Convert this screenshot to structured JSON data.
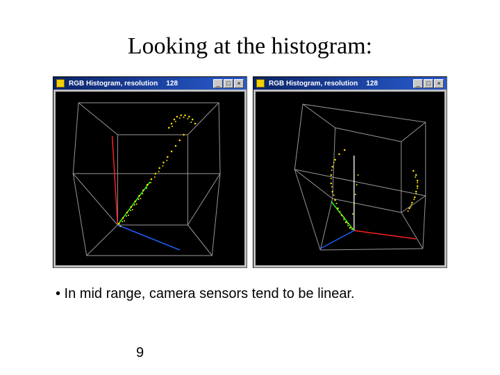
{
  "title": "Looking at the histogram:",
  "bullet": "• In mid range, camera sensors tend to be linear.",
  "page_number": "9",
  "windows": [
    {
      "app_icon": "histogram-icon",
      "title": "RGB Histogram, resolution",
      "resolution": "128",
      "min": "_",
      "max": "□",
      "close": "×"
    },
    {
      "app_icon": "histogram-icon",
      "title": "RGB Histogram, resolution",
      "resolution": "128",
      "min": "_",
      "max": "□",
      "close": "×"
    }
  ]
}
